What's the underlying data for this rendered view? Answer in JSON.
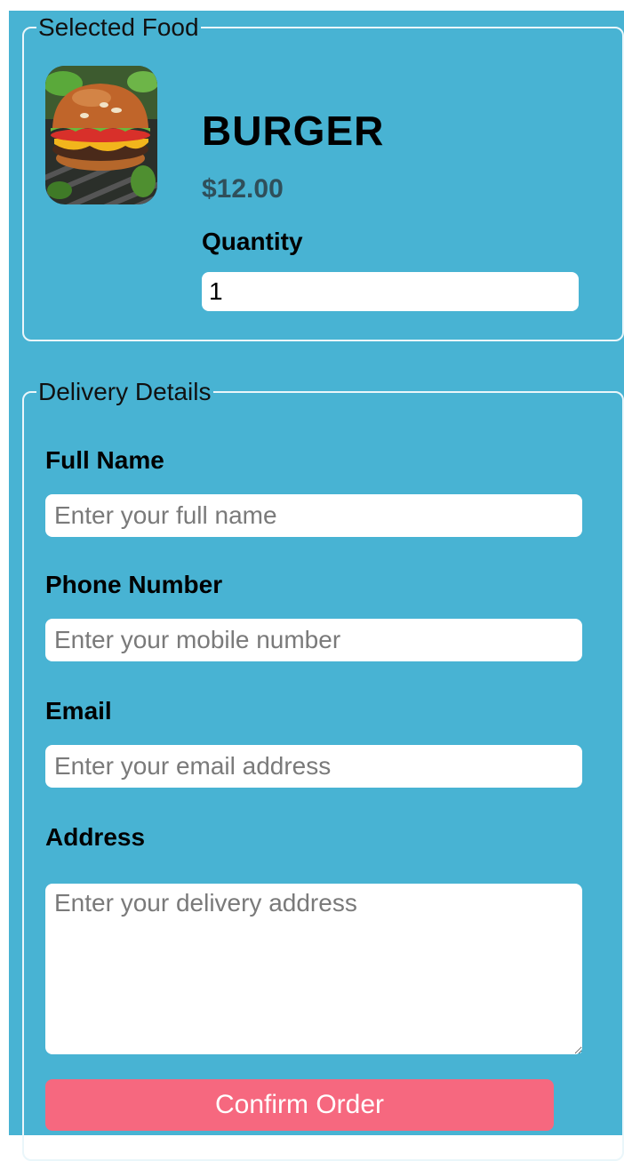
{
  "selected_food": {
    "legend": "Selected Food",
    "image_icon": "burger-photo",
    "name": "BURGER",
    "price": "$12.00",
    "quantity_label": "Quantity",
    "quantity_value": "1"
  },
  "delivery": {
    "legend": "Delivery Details",
    "full_name": {
      "label": "Full Name",
      "placeholder": "Enter your full name"
    },
    "phone": {
      "label": "Phone Number",
      "placeholder": "Enter your mobile number"
    },
    "email": {
      "label": "Email",
      "placeholder": "Enter your email address"
    },
    "address": {
      "label": "Address",
      "placeholder": "Enter your delivery address"
    },
    "confirm_label": "Confirm Order"
  },
  "colors": {
    "background": "#48b3d3",
    "button": "#f6687f",
    "fieldset_border": "#eaf6fa"
  }
}
